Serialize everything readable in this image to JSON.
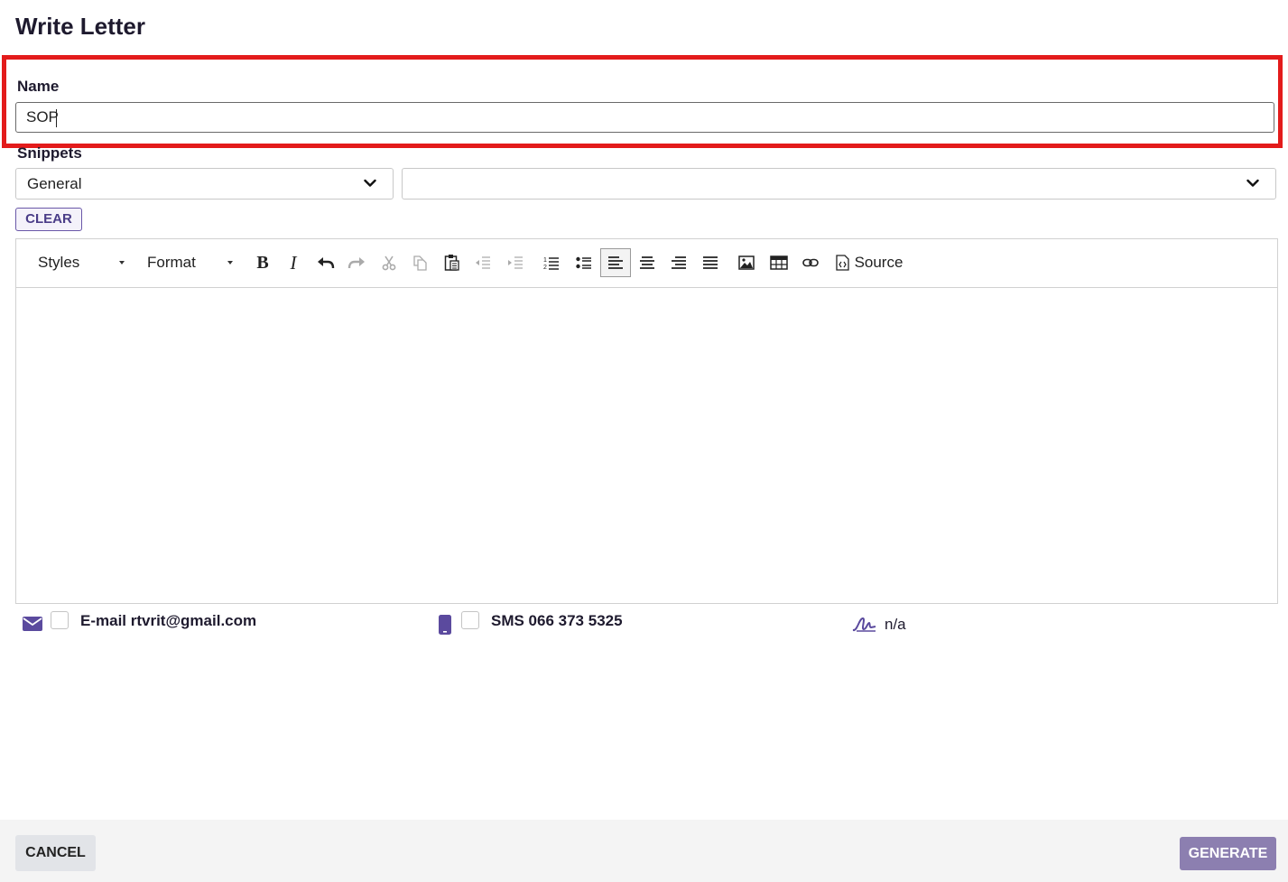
{
  "dialog": {
    "title": "Write Letter"
  },
  "name_field": {
    "label": "Name",
    "value": "SOP"
  },
  "snippets": {
    "label": "Snippets",
    "category_selected": "General",
    "snippet_selected": "",
    "clear_label": "CLEAR"
  },
  "toolbar": {
    "styles_label": "Styles",
    "format_label": "Format",
    "source_label": "Source",
    "buttons": [
      "bold-icon",
      "italic-icon",
      "undo-icon",
      "redo-icon",
      "cut-icon",
      "copy-icon",
      "paste-icon",
      "outdent-icon",
      "indent-icon",
      "numbered-list-icon",
      "bulleted-list-icon",
      "align-left-icon",
      "align-center-icon",
      "align-right-icon",
      "justify-icon",
      "image-icon",
      "table-icon",
      "link-icon",
      "source-icon"
    ]
  },
  "contacts": {
    "email": {
      "label": "E-mail rtvrit@gmail.com",
      "checked": false
    },
    "sms": {
      "label": "SMS 066 373 5325",
      "checked": false
    },
    "signature": {
      "label": "n/a"
    }
  },
  "footer": {
    "cancel_label": "CANCEL",
    "generate_label": "GENERATE"
  },
  "colors": {
    "accent": "#5b4a9e",
    "highlight": "#e31b1b",
    "generate_bg": "#8c7fb0"
  }
}
